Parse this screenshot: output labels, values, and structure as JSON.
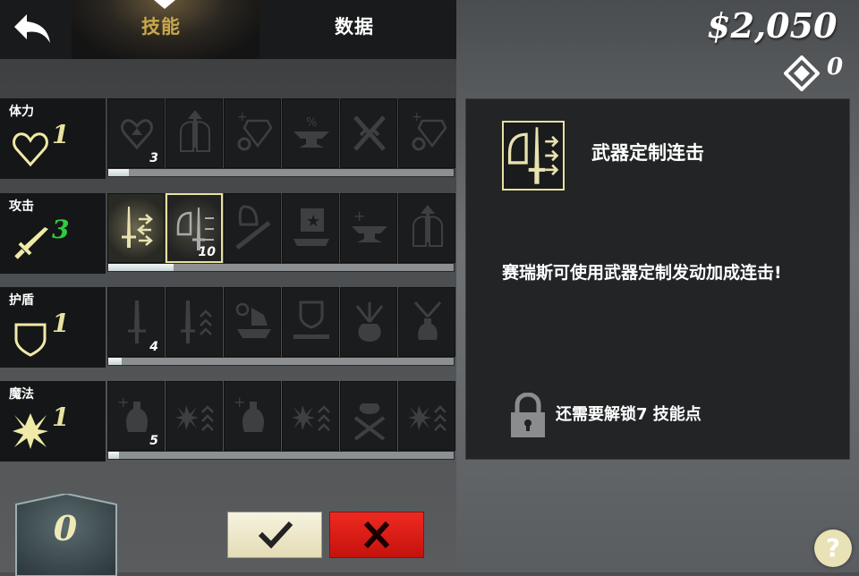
{
  "header": {
    "tabs": [
      {
        "label": "技能",
        "active": true
      },
      {
        "label": "数据",
        "active": false
      }
    ]
  },
  "currency": {
    "money_symbol": "$",
    "money": "2,050",
    "gems": "0"
  },
  "categories": [
    {
      "name": "体力",
      "level": "1",
      "level_color": "#e8e2a0",
      "icon": "heart-icon",
      "progress": 0.06,
      "slots": [
        {
          "icon": "heart-up-icon",
          "count": "3"
        },
        {
          "icon": "armor-up-icon"
        },
        {
          "icon": "gem-gear-icon"
        },
        {
          "icon": "anvil-percent-icon"
        },
        {
          "icon": "crossed-swords-icon"
        },
        {
          "icon": "gem-gear-icon"
        }
      ]
    },
    {
      "name": "攻击",
      "level": "3",
      "level_color": "#2ecc40",
      "icon": "sword-icon",
      "progress": 0.19,
      "slots": [
        {
          "icon": "sword-combo-icon",
          "state": "unlocked"
        },
        {
          "icon": "helmet-sword-combo-icon",
          "count": "10",
          "state": "selected"
        },
        {
          "icon": "helmet-sword-icon"
        },
        {
          "icon": "banner-star-icon"
        },
        {
          "icon": "anvil-plus-icon"
        },
        {
          "icon": "armor-up-icon"
        }
      ]
    },
    {
      "name": "护盾",
      "level": "1",
      "level_color": "#e8e2a0",
      "icon": "shield-icon",
      "progress": 0.04,
      "slots": [
        {
          "icon": "sword-icon",
          "count": "4"
        },
        {
          "icon": "sword-chevrons-icon"
        },
        {
          "icon": "boat-icon"
        },
        {
          "icon": "shield-bar-icon"
        },
        {
          "icon": "sack-arrows-icon"
        },
        {
          "icon": "bottle-arrows-icon"
        }
      ]
    },
    {
      "name": "魔法",
      "level": "1",
      "level_color": "#e8e2a0",
      "icon": "magic-burst-icon",
      "progress": 0.03,
      "slots": [
        {
          "icon": "bottle-plus-icon",
          "count": "5"
        },
        {
          "icon": "burst-chevrons-icon"
        },
        {
          "icon": "bottle-plus-icon"
        },
        {
          "icon": "burst-chevrons-icon"
        },
        {
          "icon": "sack-swords-icon"
        },
        {
          "icon": "burst-chevrons-icon"
        }
      ]
    }
  ],
  "detail": {
    "icon": "helmet-sword-combo-icon",
    "title": "武器定制连击",
    "description": "赛瑞斯可使用武器定制发动加成连击!",
    "lock_icon": "padlock-icon",
    "requirement": "还需要解锁7 技能点"
  },
  "skill_points": {
    "value": "0"
  },
  "buttons": {
    "confirm_icon": "checkmark-icon",
    "cancel_icon": "x-icon",
    "help_label": "?"
  },
  "colors": {
    "accent": "#e8e2a0",
    "cancel": "#e0201a",
    "level_attack": "#2ecc40"
  }
}
